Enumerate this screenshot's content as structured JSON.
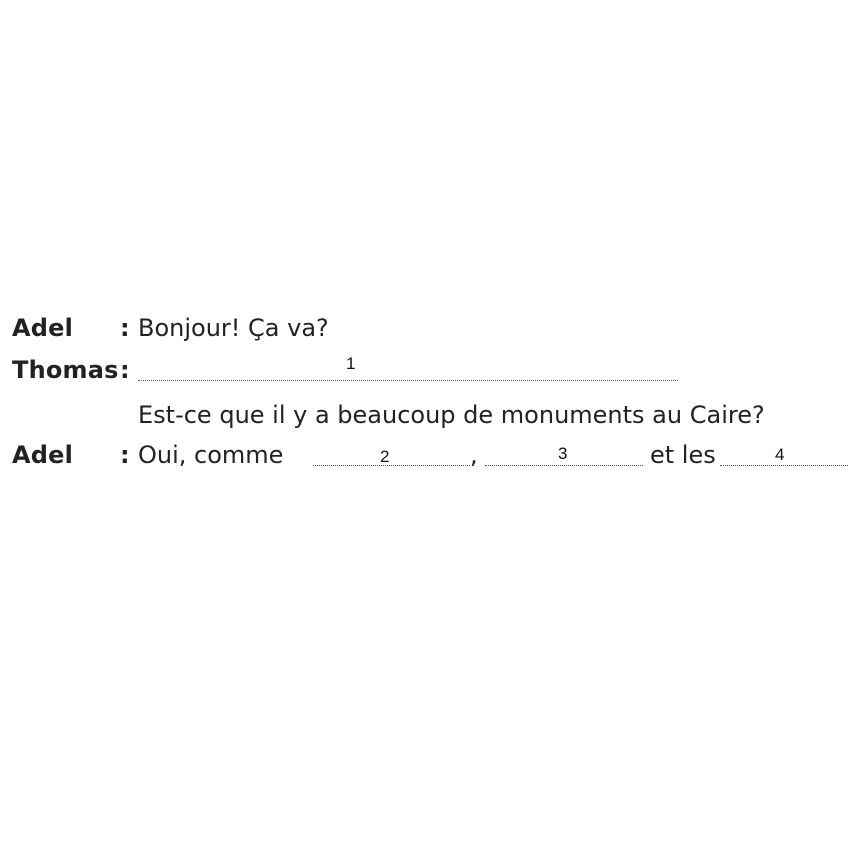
{
  "dialogue": {
    "line1": {
      "speaker": "Adel",
      "colon": ":",
      "text": "Bonjour! Ça va?"
    },
    "line2": {
      "speaker": "Thomas",
      "colon": ":",
      "blank_number": "1"
    },
    "line3": {
      "text": "Est-ce que il y a  beaucoup de monuments au Caire?"
    },
    "line4": {
      "speaker": "Adel",
      "colon": ":",
      "text_start": "Oui, comme",
      "blank2_number": "2",
      "comma": ",",
      "blank3_number": "3",
      "text_mid": "et les",
      "blank4_number": "4"
    }
  }
}
